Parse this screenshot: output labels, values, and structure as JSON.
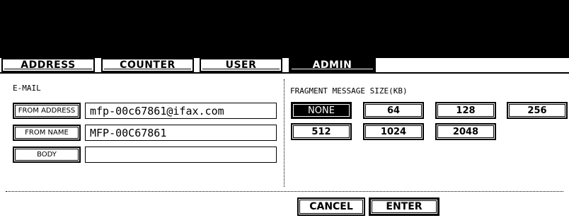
{
  "tabs": [
    "ADDRESS",
    "COUNTER",
    "USER",
    "ADMIN"
  ],
  "active_tab": "ADMIN",
  "email": {
    "section_label": "E-MAIL",
    "from_address_label": "FROM ADDRESS",
    "from_address_value": "mfp-00c67861@ifax.com",
    "from_name_label": "FROM NAME",
    "from_name_value": "MFP-00C67861",
    "body_label": "BODY",
    "body_value": ""
  },
  "fragment": {
    "section_label": "FRAGMENT MESSAGE SIZE(KB)",
    "options": [
      "NONE",
      "64",
      "128",
      "256",
      "512",
      "1024",
      "2048"
    ],
    "selected": "NONE"
  },
  "actions": {
    "cancel": "CANCEL",
    "enter": "ENTER"
  }
}
